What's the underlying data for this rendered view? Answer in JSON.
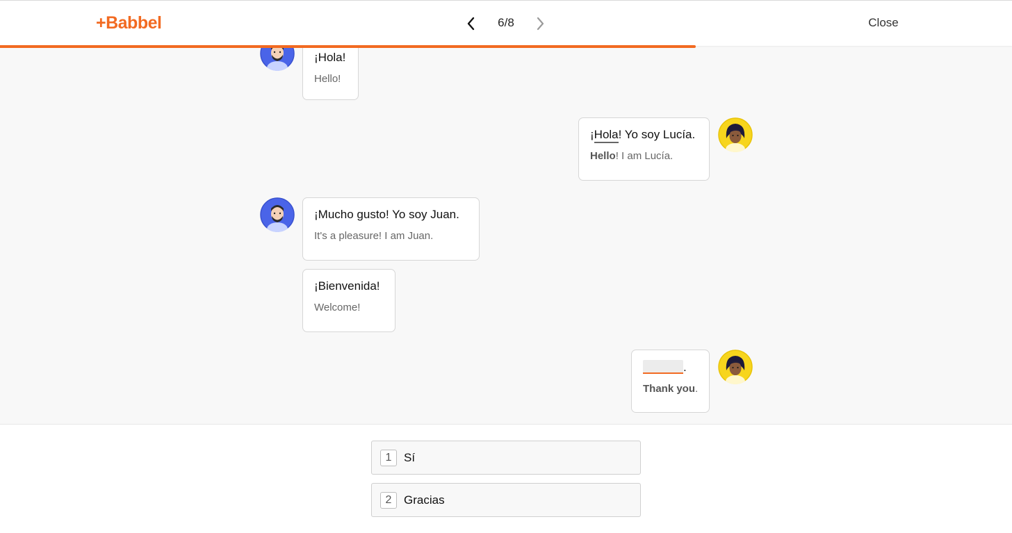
{
  "header": {
    "logo": "+Babbel",
    "counter": "6/8",
    "close_label": "Close",
    "progress_fraction": 0.6875,
    "accent_color": "#f26a21"
  },
  "dialogue": [
    {
      "speaker": "Juan",
      "side": "left",
      "text": "¡Hola!",
      "translation": "Hello!"
    },
    {
      "speaker": "Lucía",
      "side": "right",
      "text_prefix": "¡",
      "text_highlight": "Hola",
      "text_suffix": "! Yo soy Lucía.",
      "translation_bold": "Hello",
      "translation_rest": "! I am Lucía."
    },
    {
      "speaker": "Juan",
      "side": "left",
      "text": "¡Mucho gusto! Yo soy Juan.",
      "translation": "It's a pleasure! I am Juan."
    },
    {
      "speaker": "Juan",
      "side": "left",
      "text": "¡Bienvenida!",
      "translation": "Welcome!"
    },
    {
      "speaker": "Lucía",
      "side": "right",
      "text_suffix": ".",
      "translation_bold": "Thank you",
      "translation_rest": "."
    }
  ],
  "options": [
    {
      "number": "1",
      "label": "Sí"
    },
    {
      "number": "2",
      "label": "Gracias"
    }
  ],
  "icons": {
    "prev": "chevron-left-icon",
    "next": "chevron-right-icon",
    "juan_avatar": "man-avatar",
    "lucia_avatar": "woman-avatar"
  }
}
